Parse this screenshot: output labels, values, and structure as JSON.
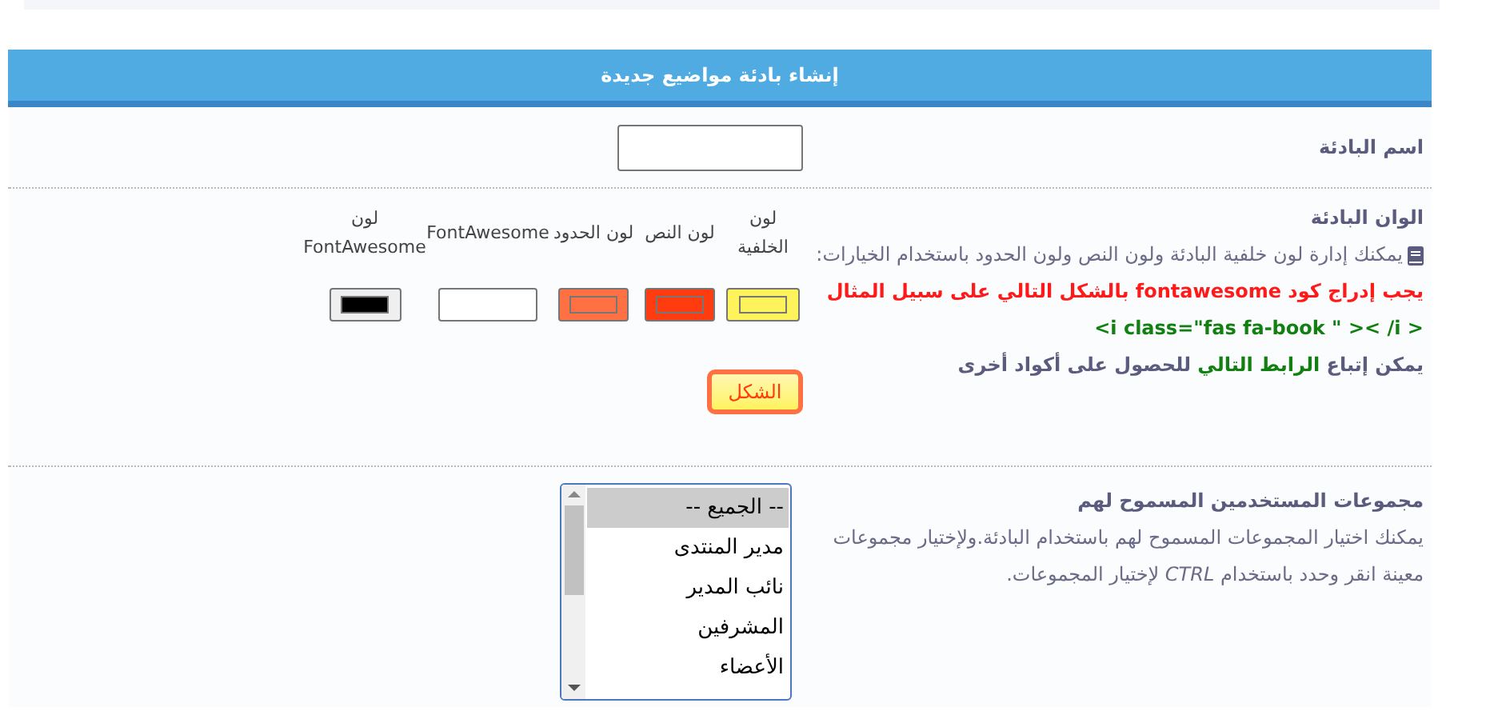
{
  "header": {
    "title": "إنشاء بادئة مواضيع جديدة"
  },
  "name_row": {
    "label": "اسم البادئة"
  },
  "colors_row": {
    "label": "الوان البادئة",
    "description": "يمكنك إدارة لون خلفية البادئة ولون النص ولون الحدود باستخدام الخيارات:",
    "warning": "يجب إدراج كود fontawesome بالشكل التالي على سبيل المثال",
    "code": "<i class=\"fas fa-book \" >< /i >",
    "link_before": "يمكن إتباع",
    "link": "الرابط التالي",
    "link_after": "للحصول على أكواد أخرى",
    "swatches": [
      {
        "label": "لون الخلفية",
        "kind": "color",
        "color": "#fff35c"
      },
      {
        "label": "لون النص",
        "kind": "color",
        "color": "#ff3c0f"
      },
      {
        "label": "لون الحدود",
        "kind": "color",
        "color": "#ff7043"
      },
      {
        "label": "FontAwesome",
        "kind": "text"
      },
      {
        "label": "لون FontAwesome",
        "kind": "color",
        "color": "#000000"
      }
    ],
    "preview_button": "الشكل"
  },
  "groups_row": {
    "label": "مجموعات المستخدمين المسموح لهم",
    "description": "يمكنك اختيار المجموعات المسموح لهم باستخدام البادئة.ولإختيار مجموعات معينة انقر وحدد باستخدام *CTRL* لإختيار المجموعات.",
    "options": [
      {
        "label": "-- الجميع --",
        "selected": true
      },
      {
        "label": "مدير المنتدى",
        "selected": false
      },
      {
        "label": "نائب المدير",
        "selected": false
      },
      {
        "label": "المشرفين",
        "selected": false
      },
      {
        "label": "الأعضاء",
        "selected": false
      }
    ]
  }
}
